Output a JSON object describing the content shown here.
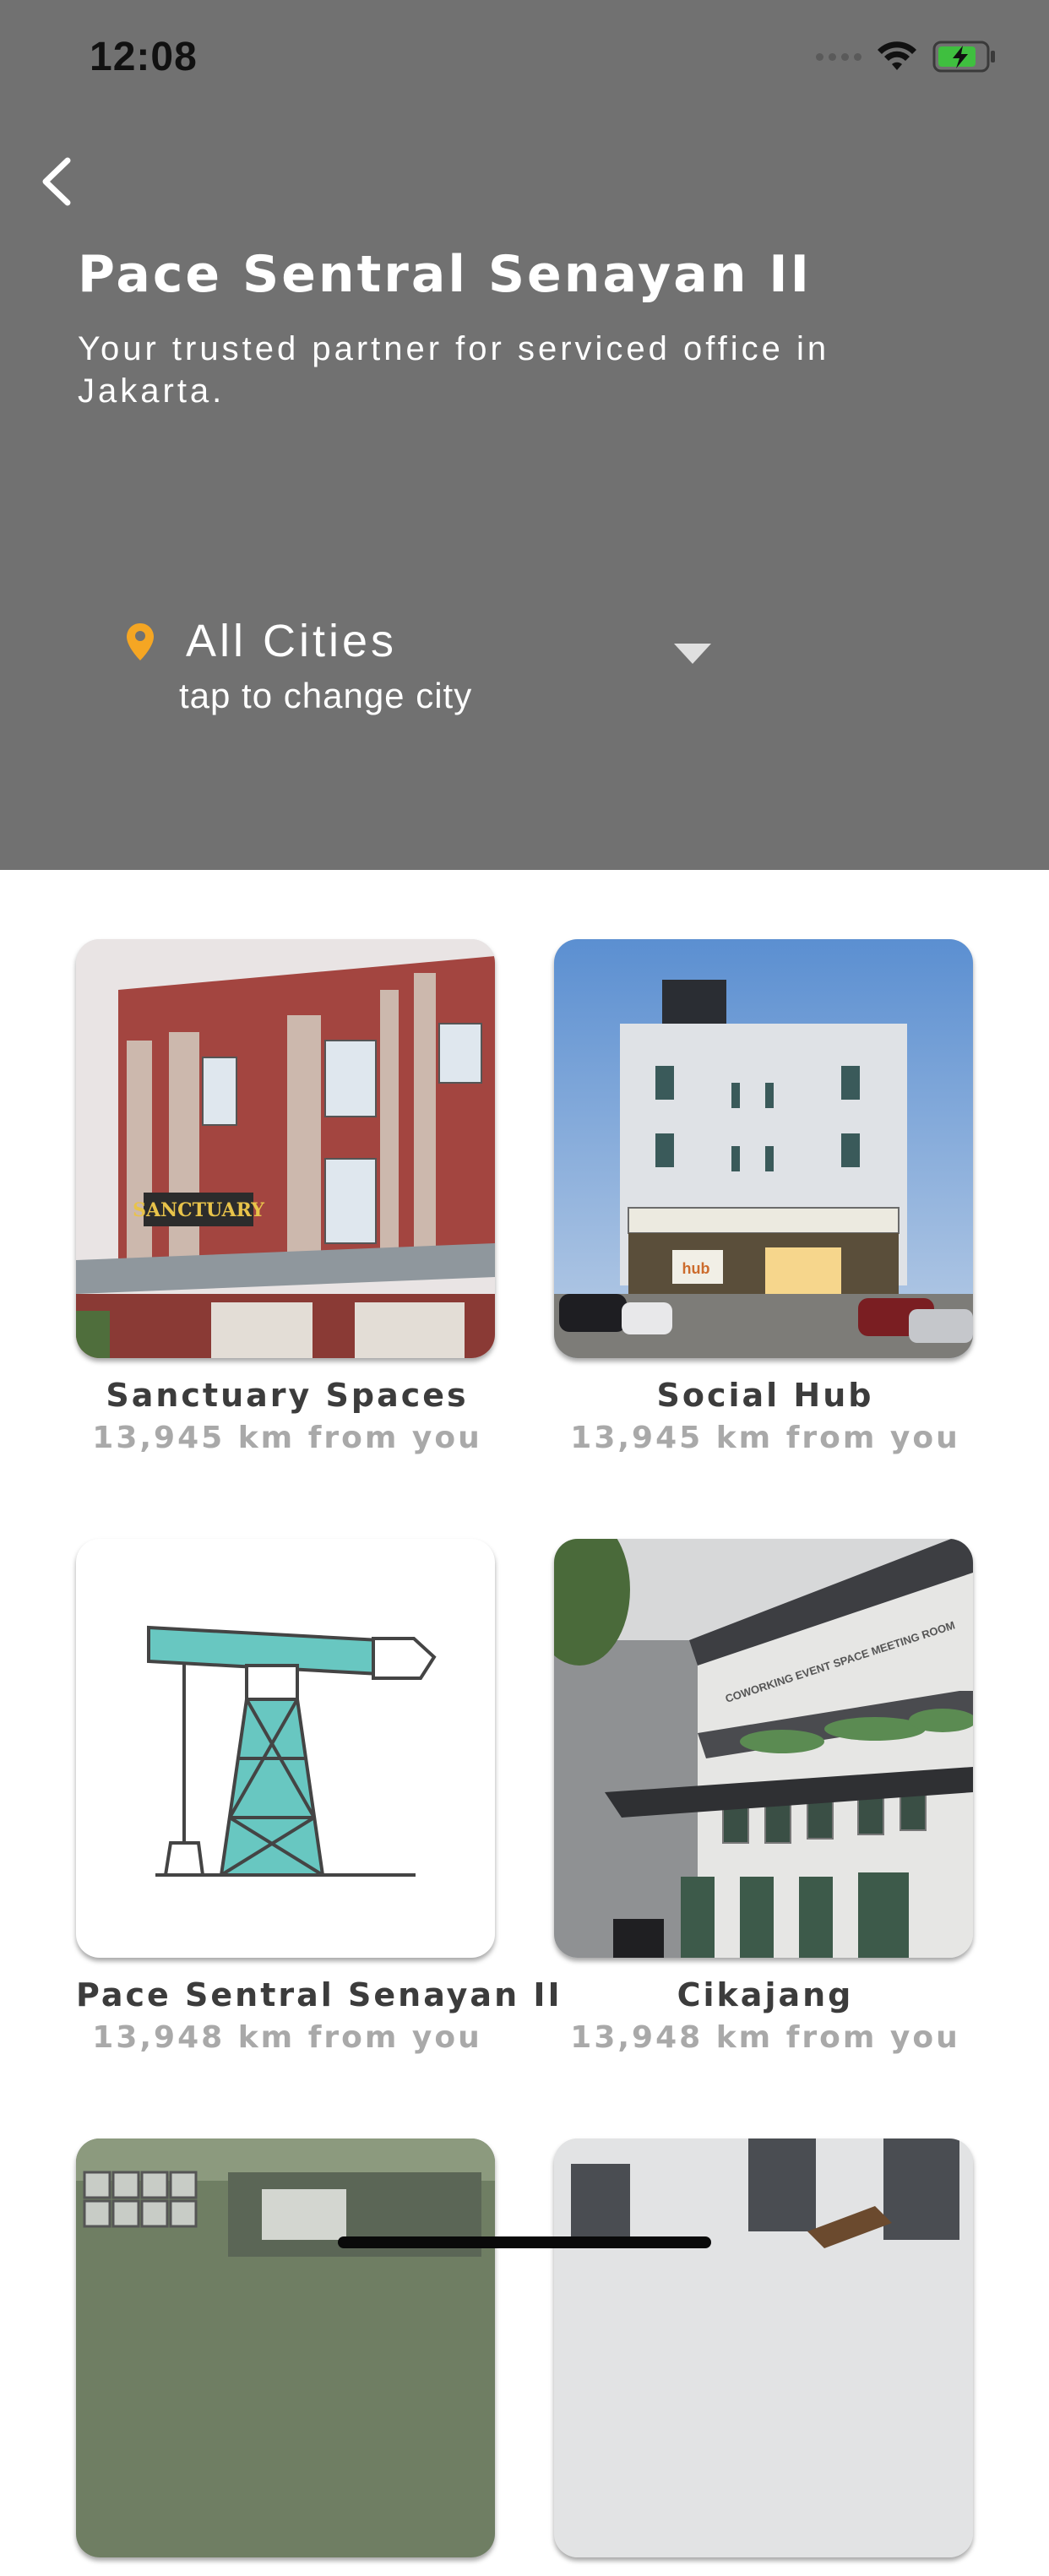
{
  "status_bar": {
    "time": "12:08"
  },
  "header": {
    "title": "Pace Sentral Senayan II",
    "subtitle": "Your trusted partner for serviced office in Jakarta."
  },
  "city_selector": {
    "city": "All Cities",
    "hint": "tap to change city"
  },
  "spaces": [
    {
      "name": "Sanctuary Spaces",
      "distance": "13,945 km from you",
      "sign_text": "SANCTUARY"
    },
    {
      "name": "Social Hub",
      "distance": "13,945 km from you",
      "sign_text": "hub"
    },
    {
      "name": "Pace Sentral Senayan II",
      "distance": "13,948 km from you"
    },
    {
      "name": "Cikajang",
      "distance": "13,948 km from you",
      "sign_text": "COWORKING EVENT SPACE MEETING ROOM"
    },
    {
      "name": "",
      "distance": ""
    },
    {
      "name": "",
      "distance": ""
    }
  ],
  "colors": {
    "header_bg": "#717171",
    "pin": "#f5a623",
    "battery": "#3fbf3f",
    "placeholder_teal": "#68c7c1"
  }
}
